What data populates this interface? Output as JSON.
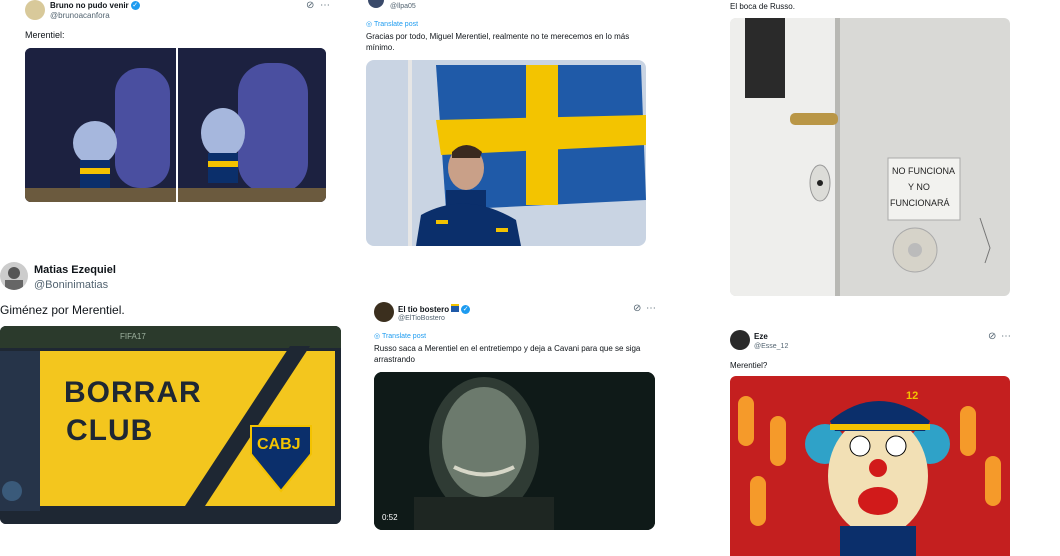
{
  "posts": [
    {
      "name": "Bruno no pudo venir",
      "handle": "@brunoacanfora",
      "text": "Merentiel:"
    },
    {
      "name": "",
      "handle": "@llpa05",
      "translate": "Translate post",
      "text": "Gracias por todo, Miguel Merentiel, realmente no te merecemos en lo más mínimo."
    },
    {
      "name": "",
      "handle": "",
      "text": "El boca de Russo.",
      "sign_text": "NO FUNCIONA Y NO FUNCIONARÁ"
    },
    {
      "name": "Matias Ezequiel",
      "handle": "@Boninimatias",
      "text": "Giménez por Merentiel.",
      "image_text_1": "BORRAR",
      "image_text_2": "CLUB",
      "badge": "CABJ",
      "corner_text": "FIFA17"
    },
    {
      "name": "El tio bostero",
      "handle": "@ElTioBostero",
      "translate": "Translate post",
      "text": "Russo saca a Merentiel en el entretiempo y deja a Cavani para que se siga arrastrando",
      "video_time": "0:52"
    },
    {
      "name": "Eze",
      "handle": "@Esse_12",
      "text": "Merentiel?",
      "cap_number": "12"
    }
  ],
  "colors": {
    "boca_blue": "#0b2f6b",
    "boca_gold": "#f3c200",
    "link": "#1d9bf0"
  }
}
